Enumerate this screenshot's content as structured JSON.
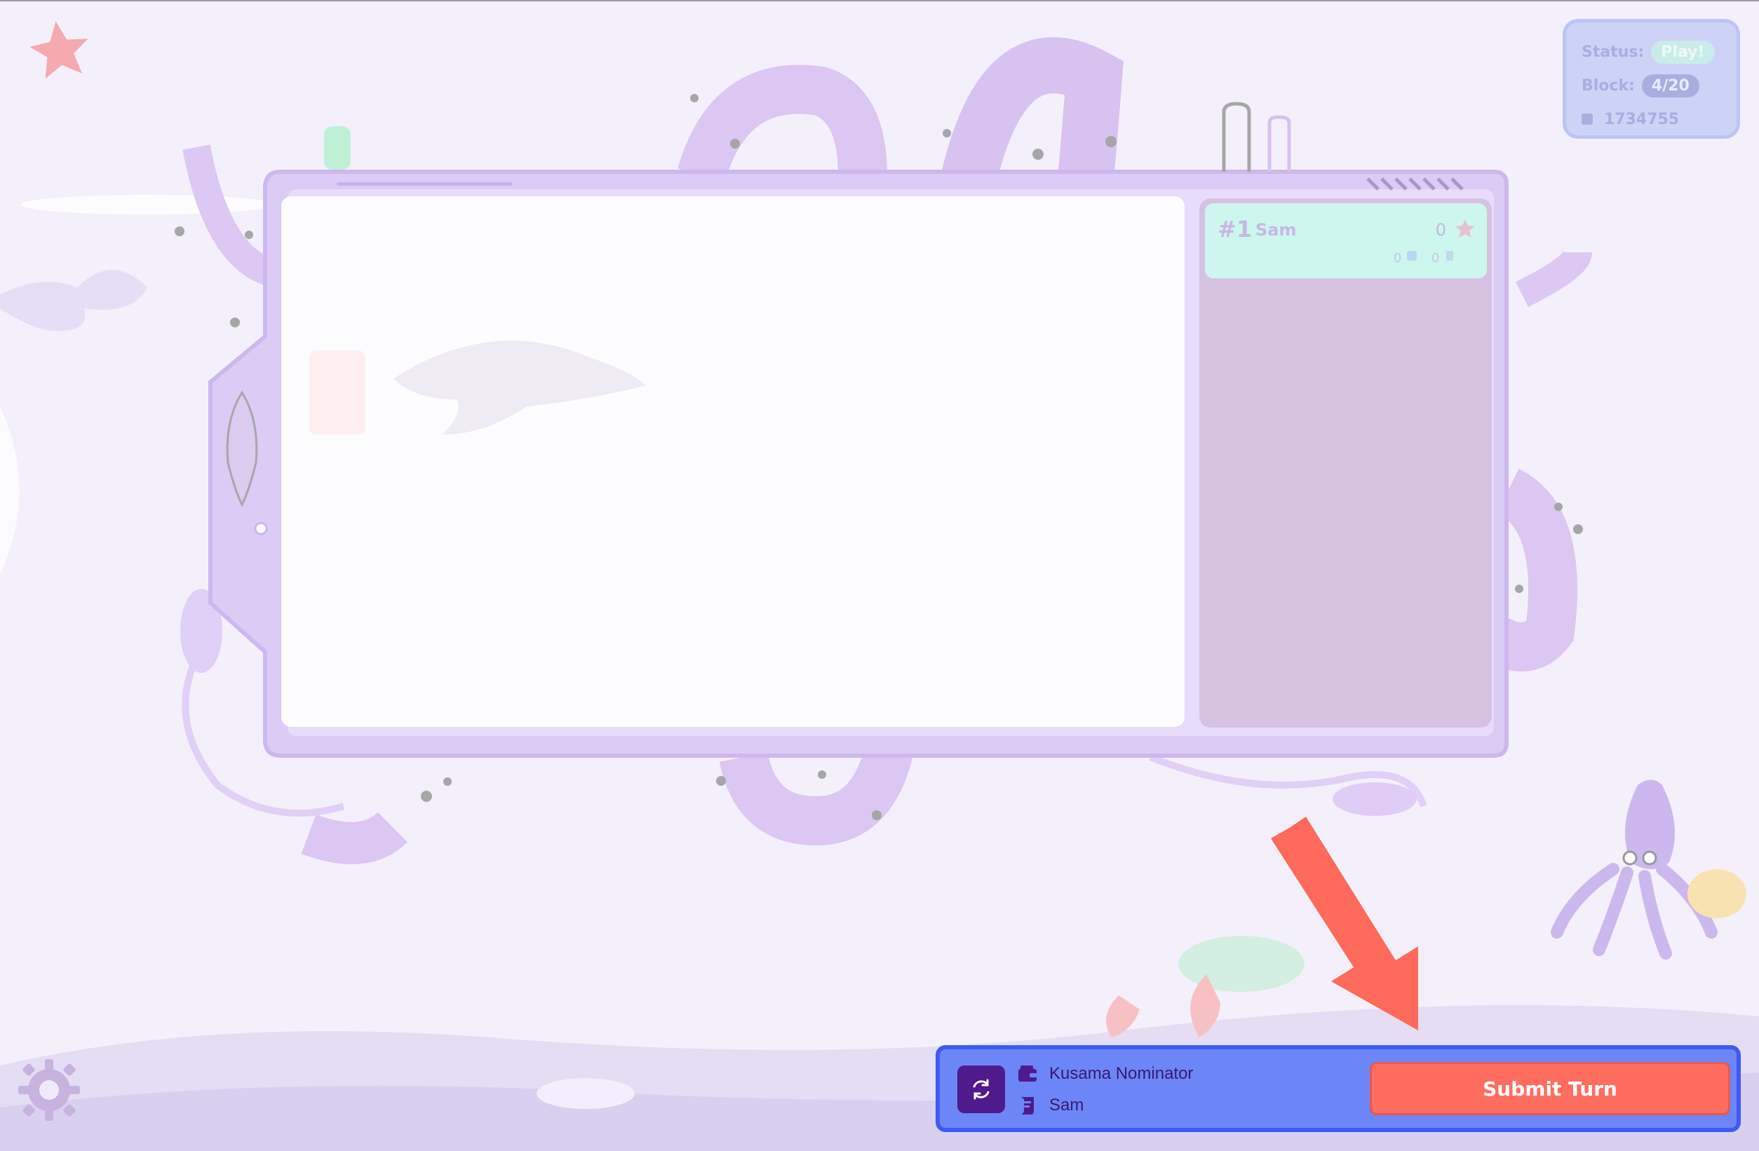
{
  "status_panel": {
    "status_label": "Status:",
    "status_value": "Play!",
    "block_label": "Block:",
    "block_value": "4/20",
    "block_number": "1734755"
  },
  "leaderboard": {
    "players": [
      {
        "rank": "#1",
        "name": "Sam",
        "score": "0",
        "stat_a": "0",
        "stat_b": "0"
      }
    ]
  },
  "bottom_bar": {
    "wallet_name": "Kusama Nominator",
    "player_name": "Sam",
    "submit_label": "Submit Turn"
  },
  "icons": {
    "refresh": "refresh-icon",
    "wallet": "wallet-icon",
    "scroll": "scroll-icon",
    "settings": "gear-icon",
    "arrow": "pointer-arrow"
  },
  "colors": {
    "accent_bar": "#6c86f7",
    "submit": "#fe6d5e",
    "player_card": "#cdf7ee",
    "refresh_btn": "#4f1a8c"
  }
}
